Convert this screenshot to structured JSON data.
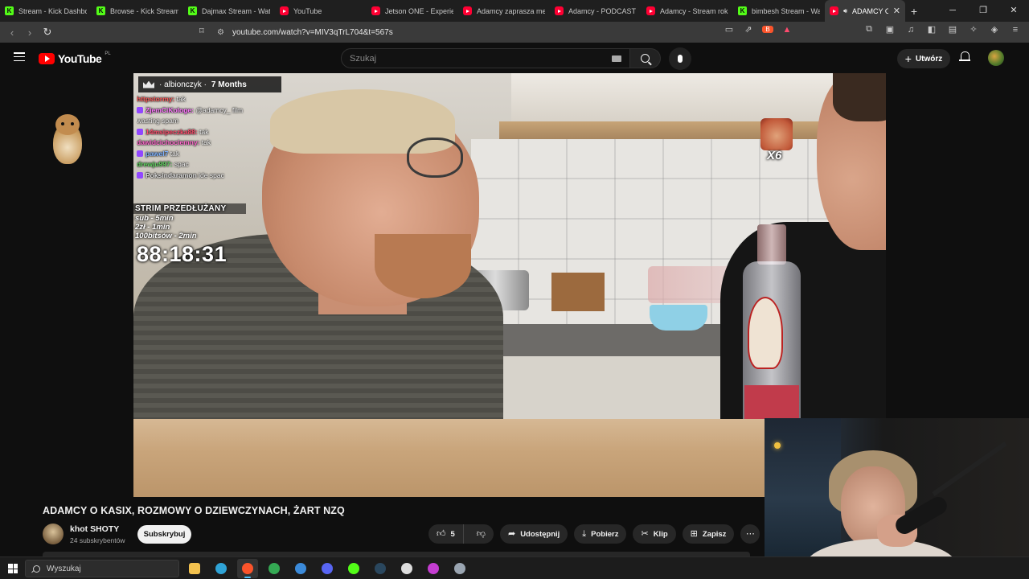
{
  "browser": {
    "tabs": [
      {
        "title": "Stream - Kick Dashboard",
        "favicon": "kick-icon",
        "active": false
      },
      {
        "title": "Browse - Kick Streaming",
        "favicon": "kick-icon",
        "active": false
      },
      {
        "title": "Dajmax Stream - Watch",
        "favicon": "kick-icon",
        "active": false
      },
      {
        "title": "YouTube",
        "favicon": "youtube-icon",
        "active": false
      },
      {
        "title": "Jetson ONE - Experience",
        "favicon": "youtube-icon",
        "active": false
      },
      {
        "title": "Adamcy zaprasza mentora",
        "favicon": "youtube-icon",
        "active": false
      },
      {
        "title": "Adamcy - PODCAST z K",
        "favicon": "youtube-icon",
        "active": false
      },
      {
        "title": "Adamcy - Stream roku",
        "favicon": "youtube-icon",
        "active": false
      },
      {
        "title": "bimbesh Stream - Watch",
        "favicon": "kick-icon",
        "active": false
      },
      {
        "title": "ADAMCY O KASIX",
        "favicon": "youtube-icon",
        "active": true
      }
    ],
    "url": "youtube.com/watch?v=MIV3qTrL704&t=567s",
    "accent_color": "#ff0033"
  },
  "youtube": {
    "logo_text": "YouTube",
    "region": "PL",
    "search_placeholder": "Szukaj",
    "create_label": "Utwórz"
  },
  "video": {
    "title": "ADAMCY O KASIX, ROZMOWY O DZIEWCZYNACH, ŻART NZQ",
    "overlay": {
      "sub_user": "· albionczyk ·",
      "sub_months": "7 Months",
      "chat": [
        {
          "user": "httpstormy:",
          "msg": "tak",
          "color": "#ff5a5a"
        },
        {
          "user": "ZjemCiKologe:",
          "msg": "@adamcy_ film",
          "color": "#ff77ff"
        },
        {
          "user": "",
          "msg": "wasting spam",
          "color": "#9aff9a"
        },
        {
          "user": "14msipeczka88:",
          "msg": "tak",
          "color": "#ff4d6d"
        },
        {
          "user": "dawidcichociemny:",
          "msg": "tak",
          "color": "#ff66cc"
        },
        {
          "user": "pawel7",
          "msg": "tak",
          "color": "#7fb3ff"
        },
        {
          "user": "drewju997:",
          "msg": "spac",
          "color": "#5fd35f"
        },
        {
          "user": "Poksindaramon",
          "msg": "ide spac",
          "color": "#e0e0e0"
        }
      ],
      "timer_title": "STRIM PRZEDŁUŻANY",
      "timer_rules": [
        "sub - 5min",
        "2zł - 1min",
        "100bitsów - 2min"
      ],
      "timer_value": "88:18:31",
      "emote_multiplier": "X6"
    }
  },
  "channel": {
    "name": "khot SHOTY",
    "subscribers": "24 subskrybentów",
    "subscribe_label": "Subskrybuj"
  },
  "actions": {
    "like_count": "5",
    "share_label": "Udostępnij",
    "download_label": "Pobierz",
    "clip_label": "Klip",
    "save_label": "Zapisz"
  },
  "taskbar": {
    "search_label": "Wyszukaj",
    "apps": [
      {
        "name": "file-explorer",
        "color": "#f2c14e",
        "active": false
      },
      {
        "name": "edge",
        "color": "#2fa3d6",
        "active": false
      },
      {
        "name": "brave",
        "color": "#fb542b",
        "active": true
      },
      {
        "name": "chrome",
        "color": "#34a853",
        "active": false
      },
      {
        "name": "ccleaner",
        "color": "#3b8ad9",
        "active": false
      },
      {
        "name": "discord",
        "color": "#5865f2",
        "active": false
      },
      {
        "name": "kick-studio",
        "color": "#53fc18",
        "active": false
      },
      {
        "name": "steam",
        "color": "#2a475e",
        "active": false
      },
      {
        "name": "obs",
        "color": "#dddddd",
        "active": false
      },
      {
        "name": "game-app",
        "color": "#c43dd1",
        "active": false
      },
      {
        "name": "other-app",
        "color": "#9aa5b1",
        "active": false
      }
    ]
  }
}
